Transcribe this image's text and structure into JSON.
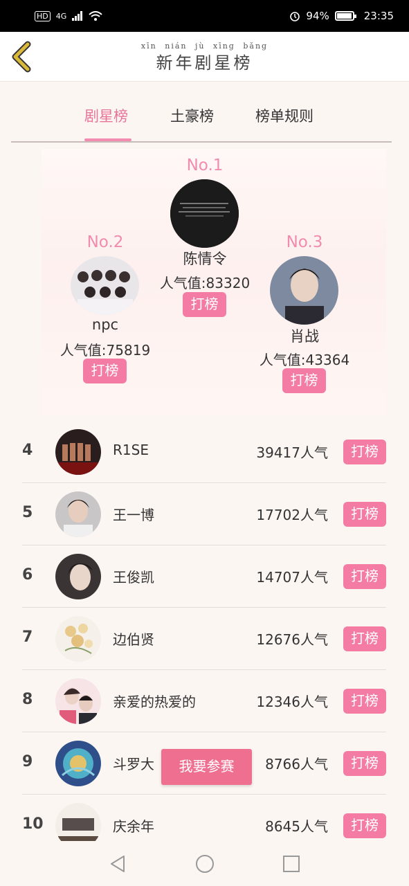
{
  "status_bar": {
    "network": "4G",
    "hd": "HD",
    "battery": "94%",
    "time": "23:35"
  },
  "header": {
    "pinyin": [
      "xīn",
      "nián",
      "jù",
      "xīng",
      "bǎng"
    ],
    "title": "新年剧星榜"
  },
  "tabs": [
    {
      "label": "剧星榜",
      "active": true
    },
    {
      "label": "土豪榜",
      "active": false
    },
    {
      "label": "榜单规则",
      "active": false
    }
  ],
  "podium": [
    {
      "rank": "No.1",
      "name": "陈情令",
      "popularity": "人气值:83320",
      "button": "打榜",
      "avatar": "dark-poster"
    },
    {
      "rank": "No.2",
      "name": "npc",
      "popularity": "人气值:75819",
      "button": "打榜",
      "avatar": "group-photo"
    },
    {
      "rank": "No.3",
      "name": "肖战",
      "popularity": "人气值:43364",
      "button": "打榜",
      "avatar": "portrait"
    }
  ],
  "list": [
    {
      "rank": "4",
      "name": "R1SE",
      "popularity": "39417人气",
      "button": "打榜",
      "avatar": "group-poster"
    },
    {
      "rank": "5",
      "name": "王一博",
      "popularity": "17702人气",
      "button": "打榜",
      "avatar": "portrait"
    },
    {
      "rank": "6",
      "name": "王俊凯",
      "popularity": "14707人气",
      "button": "打榜",
      "avatar": "portrait"
    },
    {
      "rank": "7",
      "name": "边伯贤",
      "popularity": "12676人气",
      "button": "打榜",
      "avatar": "flowers"
    },
    {
      "rank": "8",
      "name": "亲爱的热爱的",
      "popularity": "12346人气",
      "button": "打榜",
      "avatar": "couple"
    },
    {
      "rank": "9",
      "name": "斗罗大",
      "popularity": "8766人气",
      "button": "打榜",
      "avatar": "anime"
    },
    {
      "rank": "10",
      "name": "庆余年",
      "popularity": "8645人气",
      "button": "打榜",
      "avatar": "calligraphy"
    }
  ],
  "floating_button": "我要参赛",
  "colors": {
    "accent": "#f47ba3",
    "accent_text": "#f08cae",
    "join_button": "#ef6f90",
    "back_arrow": "#d9b83a"
  }
}
